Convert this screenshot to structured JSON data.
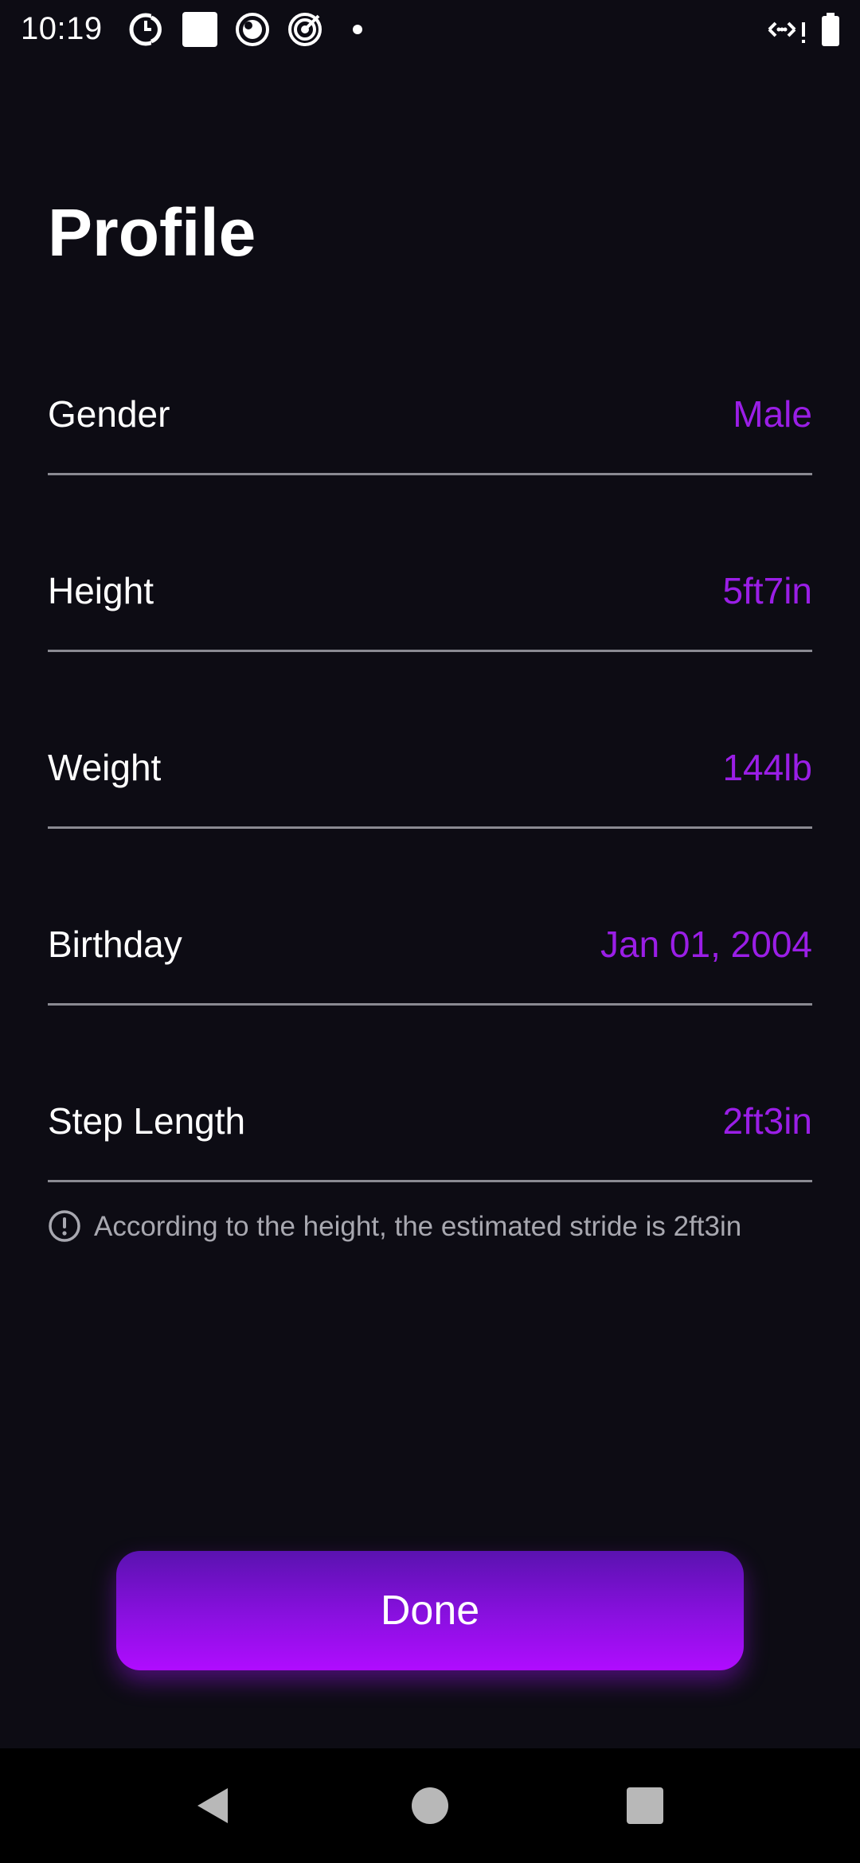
{
  "status_bar": {
    "time": "10:19",
    "icons": [
      "do-not-disturb-icon",
      "square-app-icon",
      "circle-app-icon",
      "target-app-icon",
      "notification-dot-icon",
      "data-saver-icon",
      "battery-icon"
    ]
  },
  "page": {
    "title": "Profile"
  },
  "rows": [
    {
      "label": "Gender",
      "value": "Male"
    },
    {
      "label": "Height",
      "value": "5ft7in"
    },
    {
      "label": "Weight",
      "value": "144lb"
    },
    {
      "label": "Birthday",
      "value": "Jan 01, 2004"
    },
    {
      "label": "Step Length",
      "value": "2ft3in"
    }
  ],
  "note": {
    "icon": "info-exclamation-icon",
    "text": "According to the height, the estimated stride is 2ft3in"
  },
  "done_button": {
    "label": "Done"
  },
  "nav_bar": {
    "icons": [
      "back-icon",
      "home-icon",
      "recents-icon"
    ]
  },
  "colors": {
    "background": "#0d0c14",
    "accent": "#9a1ee6",
    "divider": "#8a8a92",
    "note_text": "#a8a8b0"
  }
}
